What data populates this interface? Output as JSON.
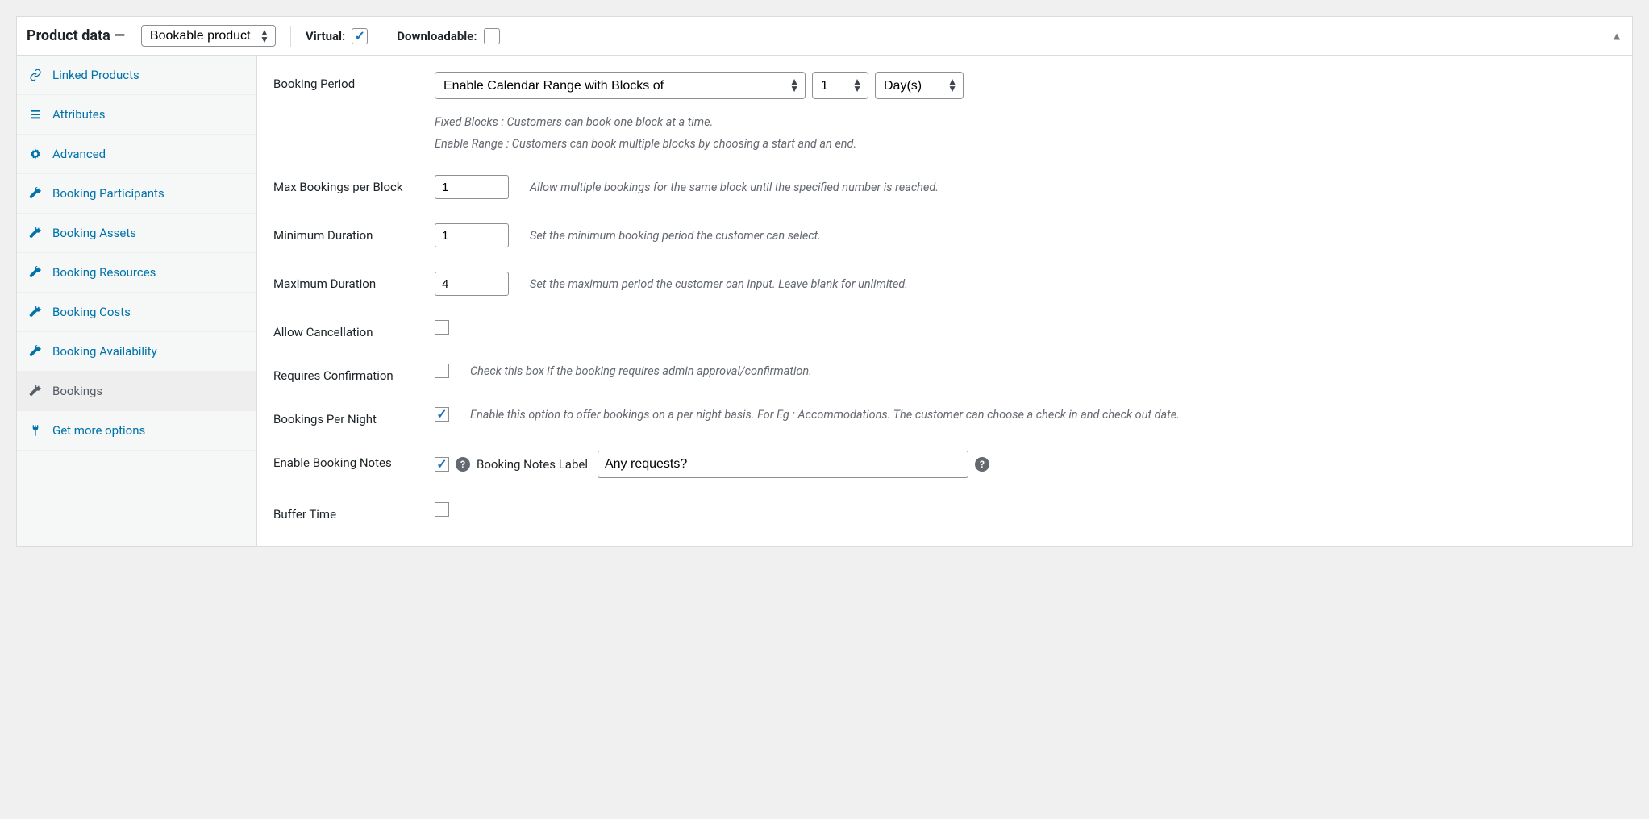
{
  "header": {
    "title": "Product data —",
    "product_type_selected": "Bookable product",
    "virtual_label": "Virtual:",
    "virtual_checked": true,
    "downloadable_label": "Downloadable:",
    "downloadable_checked": false
  },
  "tabs": [
    {
      "id": "linked",
      "label": "Linked Products",
      "icon": "link"
    },
    {
      "id": "attributes",
      "label": "Attributes",
      "icon": "list"
    },
    {
      "id": "advanced",
      "label": "Advanced",
      "icon": "gear"
    },
    {
      "id": "participants",
      "label": "Booking Participants",
      "icon": "wrench"
    },
    {
      "id": "assets",
      "label": "Booking Assets",
      "icon": "wrench"
    },
    {
      "id": "resources",
      "label": "Booking Resources",
      "icon": "wrench"
    },
    {
      "id": "costs",
      "label": "Booking Costs",
      "icon": "wrench"
    },
    {
      "id": "availability",
      "label": "Booking Availability",
      "icon": "wrench"
    },
    {
      "id": "bookings",
      "label": "Bookings",
      "icon": "wrench",
      "active": true
    },
    {
      "id": "getmore",
      "label": "Get more options",
      "icon": "plug"
    }
  ],
  "form": {
    "booking_period": {
      "label": "Booking Period",
      "mode_selected": "Enable Calendar Range with Blocks of",
      "qty": "1",
      "unit_selected": "Day(s)",
      "hint1": "Fixed Blocks : Customers can book one block at a time.",
      "hint2": "Enable Range : Customers can book multiple blocks by choosing a start and an end."
    },
    "max_per_block": {
      "label": "Max Bookings per Block",
      "value": "1",
      "hint": "Allow multiple bookings for the same block until the specified number is reached."
    },
    "min_duration": {
      "label": "Minimum Duration",
      "value": "1",
      "hint": "Set the minimum booking period the customer can select."
    },
    "max_duration": {
      "label": "Maximum Duration",
      "value": "4",
      "hint": "Set the maximum period the customer can input. Leave blank for unlimited."
    },
    "allow_cancellation": {
      "label": "Allow Cancellation",
      "checked": false
    },
    "requires_confirmation": {
      "label": "Requires Confirmation",
      "checked": false,
      "hint": "Check this box if the booking requires admin approval/confirmation."
    },
    "per_night": {
      "label": "Bookings Per Night",
      "checked": true,
      "hint": "Enable this option to offer bookings on a per night basis. For Eg : Accommodations. The customer can choose a check in and check out date."
    },
    "booking_notes": {
      "label": "Enable Booking Notes",
      "checked": true,
      "notes_label": "Booking Notes Label",
      "notes_value": "Any requests?"
    },
    "buffer_time": {
      "label": "Buffer Time",
      "checked": false
    }
  }
}
